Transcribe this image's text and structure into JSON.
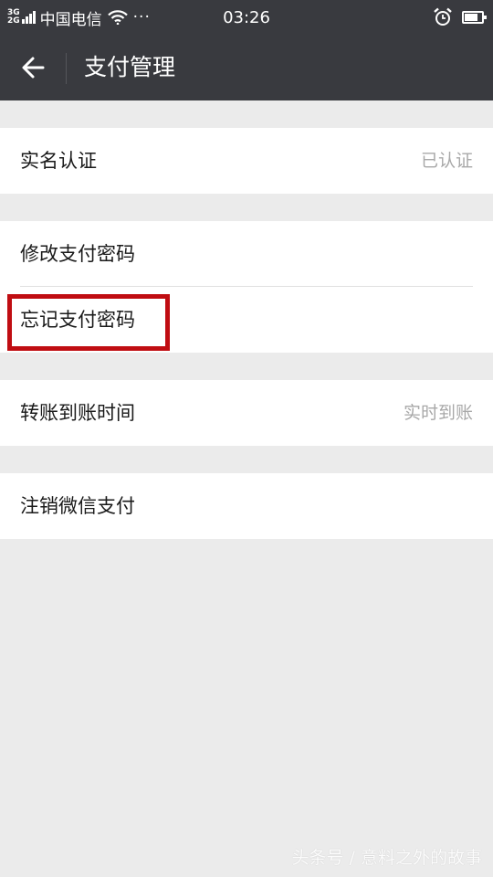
{
  "status_bar": {
    "network_top": "3G",
    "network_bottom": "2G",
    "carrier": "中国电信",
    "more": "···",
    "time": "03:26",
    "battery_level": 0.8
  },
  "header": {
    "title": "支付管理"
  },
  "groups": [
    {
      "items": [
        {
          "label": "实名认证",
          "value": "已认证"
        }
      ]
    },
    {
      "items": [
        {
          "label": "修改支付密码"
        },
        {
          "label": "忘记支付密码"
        }
      ]
    },
    {
      "items": [
        {
          "label": "转账到账时间",
          "value": "实时到账"
        }
      ]
    },
    {
      "items": [
        {
          "label": "注销微信支付"
        }
      ]
    }
  ],
  "watermark": "头条号 / 意料之外的故事",
  "colors": {
    "header_bg": "#393a3f",
    "page_bg": "#ebebeb",
    "highlight": "#c00d12"
  },
  "icons": {
    "back": "arrow-left-icon",
    "alarm": "alarm-clock-icon",
    "wifi": "wifi-icon",
    "battery": "battery-icon",
    "signal": "signal-bars-icon"
  }
}
